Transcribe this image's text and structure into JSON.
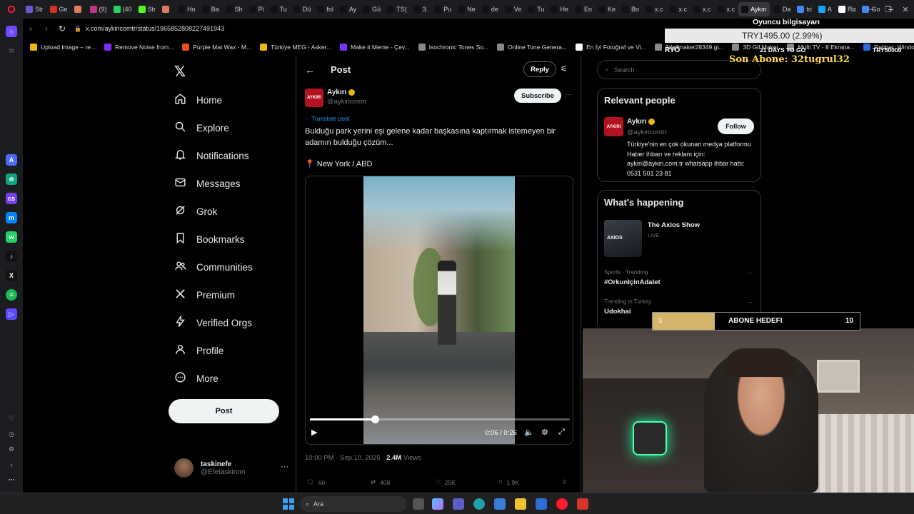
{
  "browser": {
    "tabs": [
      {
        "label": "Str",
        "icon": "stream-icon",
        "color": "#6a5acd"
      },
      {
        "label": "Ge",
        "icon": "gmail-icon",
        "color": "#d93025"
      },
      {
        "label": "",
        "icon": "tab-icon",
        "color": "#e07a5f"
      },
      {
        "label": "(9)",
        "icon": "instagram-icon",
        "color": "#c13584"
      },
      {
        "label": "(40",
        "icon": "whatsapp-icon",
        "color": "#25d366"
      },
      {
        "label": "Str",
        "icon": "kick-icon",
        "color": "#53fc18"
      },
      {
        "label": "",
        "icon": "tab-icon",
        "color": "#e07a5f"
      },
      {
        "label": "Ho",
        "icon": "x-icon",
        "color": "#111"
      },
      {
        "label": "Ba",
        "icon": "x-icon",
        "color": "#111"
      },
      {
        "label": "Sh",
        "icon": "x-icon",
        "color": "#111"
      },
      {
        "label": "Pi",
        "icon": "x-icon",
        "color": "#111"
      },
      {
        "label": "Tu",
        "icon": "x-icon",
        "color": "#111"
      },
      {
        "label": "Dü",
        "icon": "x-icon",
        "color": "#111"
      },
      {
        "label": "fol",
        "icon": "x-icon",
        "color": "#111"
      },
      {
        "label": "Ay",
        "icon": "x-icon",
        "color": "#111"
      },
      {
        "label": "Gü",
        "icon": "x-icon",
        "color": "#111"
      },
      {
        "label": "TS(",
        "icon": "x-icon",
        "color": "#111"
      },
      {
        "label": "3.",
        "icon": "x-icon",
        "color": "#111"
      },
      {
        "label": "Pu",
        "icon": "x-icon",
        "color": "#111"
      },
      {
        "label": "Ne",
        "icon": "x-icon",
        "color": "#111"
      },
      {
        "label": "de",
        "icon": "x-icon",
        "color": "#111"
      },
      {
        "label": "Ve",
        "icon": "x-icon",
        "color": "#111"
      },
      {
        "label": "Tu",
        "icon": "x-icon",
        "color": "#111"
      },
      {
        "label": "He",
        "icon": "x-icon",
        "color": "#111"
      },
      {
        "label": "En",
        "icon": "x-icon",
        "color": "#111"
      },
      {
        "label": "Ke",
        "icon": "x-icon",
        "color": "#111"
      },
      {
        "label": "Bo",
        "icon": "x-icon",
        "color": "#111"
      },
      {
        "label": "x.c",
        "icon": "x-icon",
        "color": "#111"
      },
      {
        "label": "x.c",
        "icon": "x-icon",
        "color": "#111"
      },
      {
        "label": "x.c",
        "icon": "x-icon",
        "color": "#111"
      },
      {
        "label": "x.c",
        "icon": "x-icon",
        "color": "#111"
      },
      {
        "label": "Aykırı",
        "icon": "x-icon",
        "color": "#111",
        "active": true
      },
      {
        "label": "Da",
        "icon": "x-icon",
        "color": "#111"
      },
      {
        "label": "tri",
        "icon": "google-icon",
        "color": "#4285f4"
      },
      {
        "label": "A",
        "icon": "drop-icon",
        "color": "#1da1f2"
      },
      {
        "label": "Ru",
        "icon": "wiki-icon",
        "color": "#ffffff"
      },
      {
        "label": "Go",
        "icon": "google-icon",
        "color": "#4285f4"
      }
    ],
    "url": "x.com/aykiricomtr/status/1965852808227491943",
    "bookmarks": [
      {
        "label": "Upload Image – re...",
        "color": "#f2b705"
      },
      {
        "label": "Remove Noise from...",
        "color": "#7b2ff7"
      },
      {
        "label": "Purple Mat Wax - M...",
        "color": "#e94e1b"
      },
      {
        "label": "Türkiye MEG - Asker...",
        "color": "#f2b705"
      },
      {
        "label": "Make it Meme - Çev...",
        "color": "#7b2ff7"
      },
      {
        "label": "Isochronic Tones So...",
        "color": "#888888"
      },
      {
        "label": "Online Tone Genera...",
        "color": "#888888"
      },
      {
        "label": "En İyi Fotoğraf ve Vi...",
        "color": "#ffffff"
      },
      {
        "label": "3dgifmaker28349.gi...",
        "color": "#888888"
      },
      {
        "label": "3D Gif Maker",
        "color": "#888888"
      },
      {
        "label": "Multi TV - 8 Ekrana...",
        "color": "#888888"
      },
      {
        "label": "Rehber: Windows 1...",
        "color": "#2a6dd9"
      }
    ]
  },
  "nav": {
    "items": [
      {
        "label": "Home",
        "icon": "home-icon"
      },
      {
        "label": "Explore",
        "icon": "search-icon"
      },
      {
        "label": "Notifications",
        "icon": "bell-icon"
      },
      {
        "label": "Messages",
        "icon": "mail-icon"
      },
      {
        "label": "Grok",
        "icon": "grok-icon"
      },
      {
        "label": "Bookmarks",
        "icon": "bookmark-icon"
      },
      {
        "label": "Communities",
        "icon": "people-icon"
      },
      {
        "label": "Premium",
        "icon": "x-icon"
      },
      {
        "label": "Verified Orgs",
        "icon": "lightning-icon"
      },
      {
        "label": "Profile",
        "icon": "person-icon"
      },
      {
        "label": "More",
        "icon": "more-circle-icon"
      }
    ],
    "post_label": "Post",
    "account": {
      "name": "taskinefe",
      "handle": "@Efetaskinnn"
    }
  },
  "post": {
    "header_title": "Post",
    "reply_label": "Reply",
    "author_name": "Aykırı",
    "author_handle": "@aykiricomtr",
    "avatar_text": "AYKIRI",
    "subscribe_label": "Subscribe",
    "translate_label": "Translate post",
    "text": "Bulduğu park yerini eşi gelene kadar başkasına kaptırmak istemeyen bir adamın bulduğu çözüm...",
    "location": "📍 New York / ABD",
    "video": {
      "time": "0:06 / 0:26",
      "progress": 0.25
    },
    "timestamp": "10:00 PM · Sep 10, 2025 · ",
    "views_count": "2.4M",
    "views_label": " Views",
    "stats": {
      "replies": "66",
      "reposts": "408",
      "likes": "25K",
      "bookmarks": "1.9K"
    }
  },
  "sidebar": {
    "search_placeholder": "Search",
    "relevant_title": "Relevant people",
    "relevant": {
      "name": "Aykırı",
      "handle": "@aykiricomtr",
      "follow_label": "Follow",
      "bio": "Türkiye'nin en çok okunan medya platformu Haber ihbarı ve reklam için: aykiri@aykiri.com.tr whatsapp ihbar hattı: 0531 501 23 81"
    },
    "happening_title": "What's happening",
    "show": {
      "title": "The Axios Show",
      "status": "LIVE",
      "thumb_text": "AXIOS"
    },
    "trends": [
      {
        "meta": "Sports · Trending",
        "name": "#OrkunIçinAdalet"
      },
      {
        "meta": "Trending in Turkey",
        "name": "Udokhai"
      }
    ]
  },
  "overlay": {
    "pc_label": "Oyuncu bilgisayarı",
    "price": "TRY1495.00 (2.99%)",
    "ry_label": "RYÖ",
    "days_label": "21 DAYS TO GO",
    "target_label": "TRY50000",
    "son_abone": "Son Abone: 32tugrul32",
    "goal": {
      "current": "3",
      "label": "ABONE HEDEFI",
      "max": "10",
      "current_value": 3,
      "max_value": 10
    }
  },
  "taskbar": {
    "search_label": "Ara"
  }
}
